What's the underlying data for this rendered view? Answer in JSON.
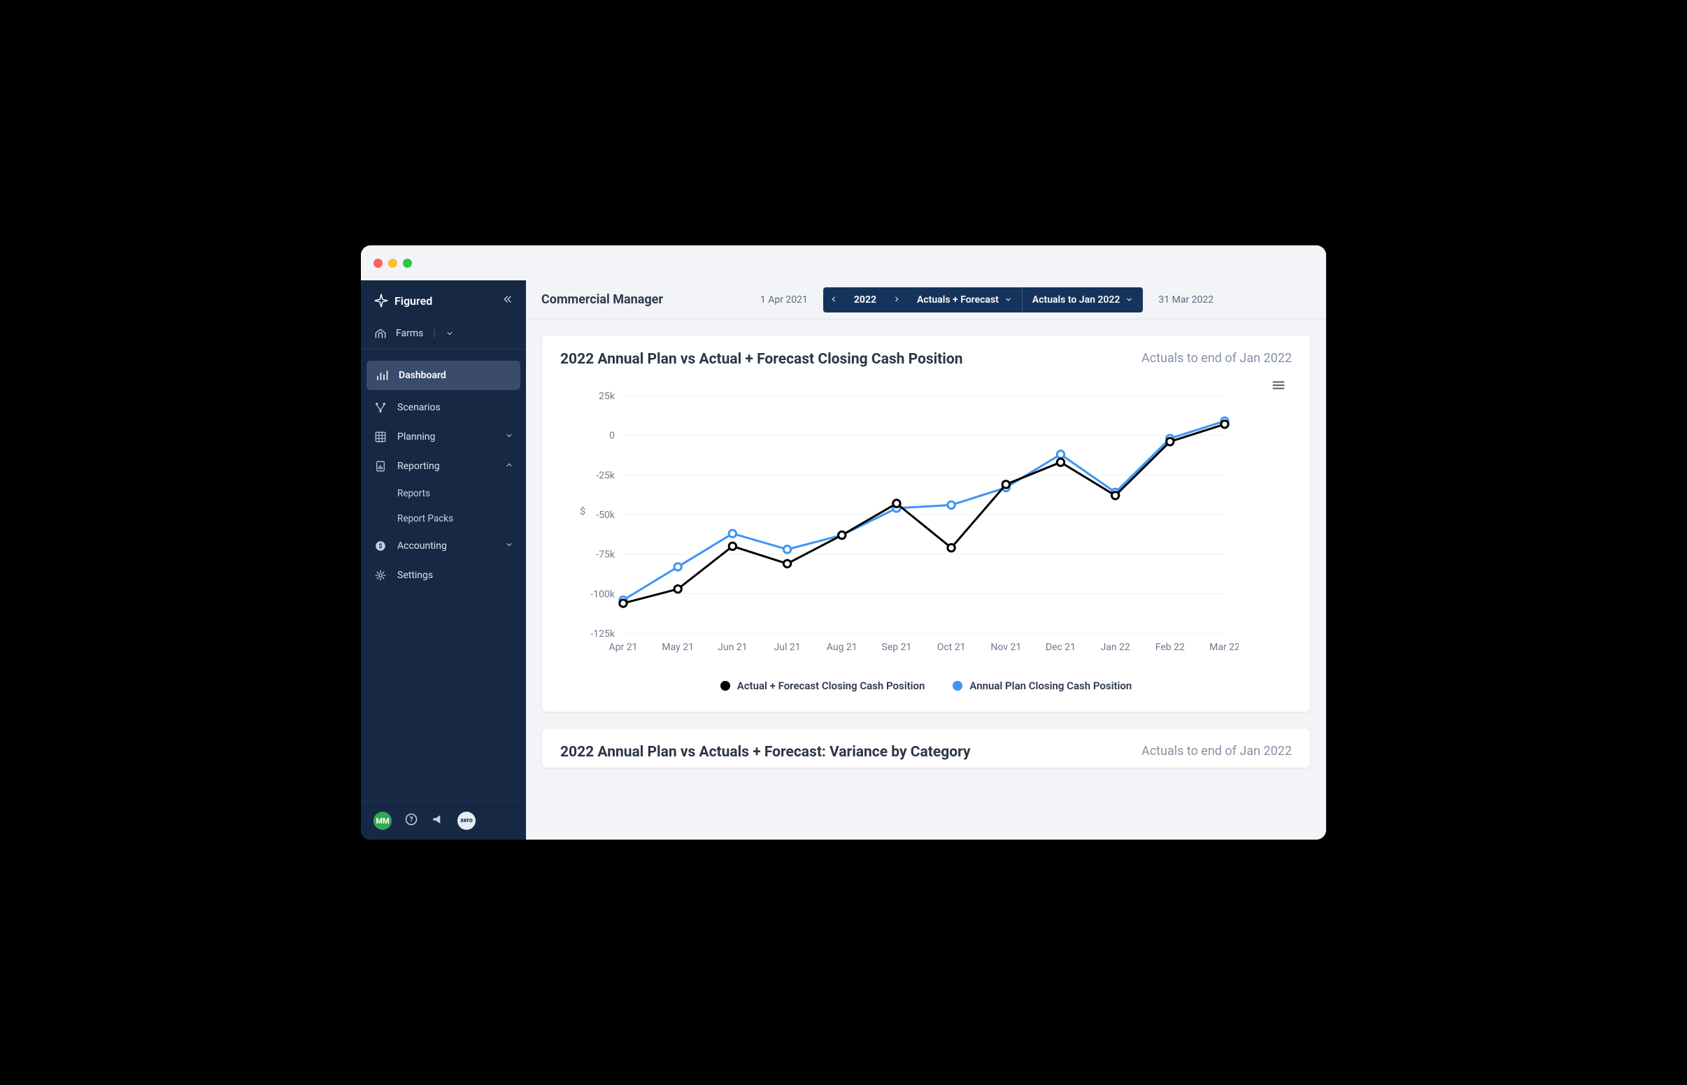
{
  "brand": "Figured",
  "sidebar": {
    "farms_label": "Farms",
    "items": [
      {
        "label": "Dashboard"
      },
      {
        "label": "Scenarios"
      },
      {
        "label": "Planning"
      },
      {
        "label": "Reporting"
      },
      {
        "label": "Accounting"
      },
      {
        "label": "Settings"
      }
    ],
    "reporting_sub": [
      {
        "label": "Reports"
      },
      {
        "label": "Report Packs"
      }
    ],
    "avatar_initials": "MM"
  },
  "topbar": {
    "page_title": "Commercial Manager",
    "start_date": "1 Apr 2021",
    "year_label": "2022",
    "mode_label": "Actuals + Forecast",
    "actuals_to_label": "Actuals to Jan 2022",
    "end_date": "31 Mar 2022"
  },
  "card1": {
    "title": "2022 Annual Plan vs Actual + Forecast Closing Cash Position",
    "subtitle": "Actuals to end of Jan 2022"
  },
  "card2": {
    "title": "2022 Annual Plan vs Actuals + Forecast: Variance by Category",
    "subtitle": "Actuals to end of Jan 2022"
  },
  "chart_data": {
    "type": "line",
    "title": "2022 Annual Plan vs Actual + Forecast Closing Cash Position",
    "xlabel": "",
    "ylabel": "$",
    "ylim": [
      -125000,
      25000
    ],
    "yticks": [
      -125000,
      -100000,
      -75000,
      -50000,
      -25000,
      0,
      25000
    ],
    "ytick_labels": [
      "-125k",
      "-100k",
      "-75k",
      "-50k",
      "-25k",
      "0",
      "25k"
    ],
    "categories": [
      "Apr 21",
      "May 21",
      "Jun 21",
      "Jul 21",
      "Aug 21",
      "Sep 21",
      "Oct 21",
      "Nov 21",
      "Dec 21",
      "Jan 22",
      "Feb 22",
      "Mar 22"
    ],
    "series": [
      {
        "name": "Actual + Forecast Closing Cash Position",
        "color": "#000000",
        "values": [
          -106000,
          -97000,
          -70000,
          -81000,
          -63000,
          -43000,
          -71000,
          -31000,
          -17000,
          -38000,
          -4000,
          7000
        ]
      },
      {
        "name": "Annual Plan Closing Cash Position",
        "color": "#3e95f4",
        "values": [
          -104000,
          -83000,
          -62000,
          -72000,
          -63000,
          -46000,
          -44000,
          -33000,
          -12000,
          -36000,
          -2000,
          9000
        ]
      }
    ]
  }
}
